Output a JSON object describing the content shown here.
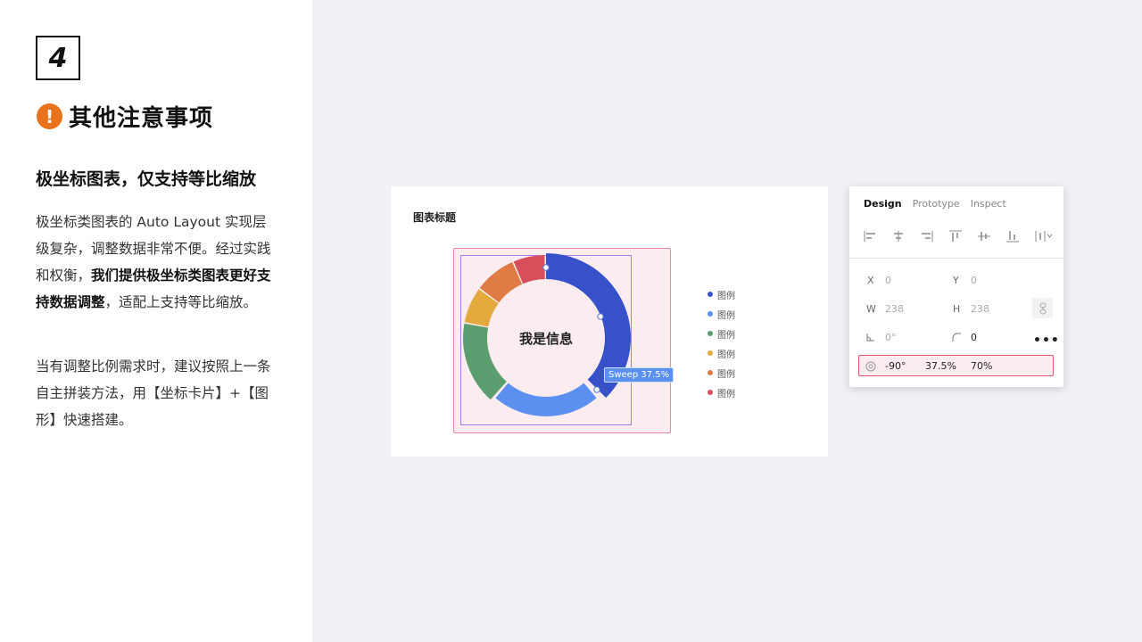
{
  "left": {
    "number": "4",
    "warn_glyph": "!",
    "title": "其他注意事项",
    "subhead": "极坐标图表，仅支持等比缩放",
    "para1_a": "极坐标类图表的 Auto Layout 实现层级复杂，调整数据非常不便。经过实践和权衡，",
    "para1_bold": "我们提供极坐标类图表更好支持数据调整",
    "para1_b": "，适配上支持等比缩放。",
    "para2": "当有调整比例需求时，建议按照上一条自主拼装方法，用【坐标卡片】+【图形】快速搭建。"
  },
  "card": {
    "title": "图表标题",
    "center_label": "我是信息",
    "sweep_tag": "Sweep 37.5%",
    "legend": [
      {
        "label": "图例",
        "color": "#3651c9"
      },
      {
        "label": "图例",
        "color": "#5b8ff0"
      },
      {
        "label": "图例",
        "color": "#5a9e6f"
      },
      {
        "label": "图例",
        "color": "#e3a93c"
      },
      {
        "label": "图例",
        "color": "#e07b45"
      },
      {
        "label": "图例",
        "color": "#d64f5a"
      }
    ]
  },
  "panel": {
    "tabs": [
      "Design",
      "Prototype",
      "Inspect"
    ],
    "active_tab": "Design",
    "x_label": "X",
    "x_value": "0",
    "y_label": "Y",
    "y_value": "0",
    "w_label": "W",
    "w_value": "238",
    "h_label": "H",
    "h_value": "238",
    "rotation_value": "0°",
    "radius_value": "0",
    "more": "•••",
    "arc_start": "-90°",
    "arc_sweep": "37.5%",
    "arc_ratio": "70%"
  },
  "colors": {
    "accent_warn": "#e8731c",
    "selection": "#e98aa0",
    "inner_selection": "#a57bf0"
  }
}
